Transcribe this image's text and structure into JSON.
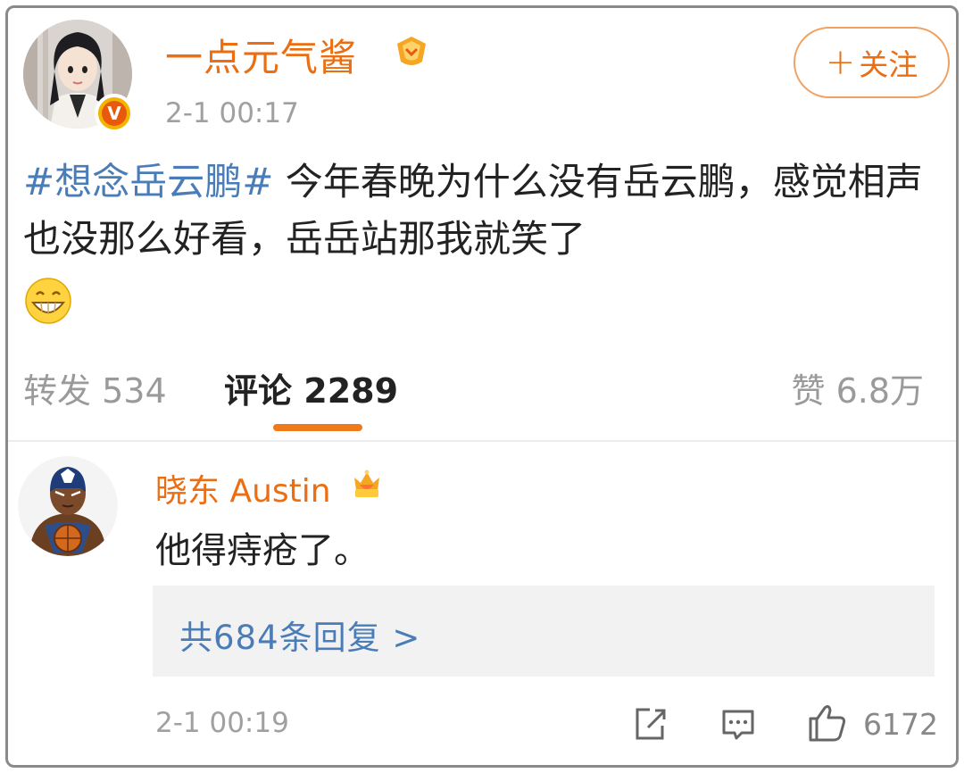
{
  "post": {
    "username": "一点元气酱",
    "time": "2-1 00:17",
    "follow_label": "关注",
    "follow_plus": "+",
    "verified_mark": "V",
    "hashtag": "#想念岳云鹏#",
    "text": " 今年春晚为什么没有岳云鹏，感觉相声也没那么好看，岳岳站那我就笑了",
    "emoji": "grinning-face-emoji"
  },
  "stats": {
    "repost_label": "转发",
    "repost_count": "534",
    "comment_label": "评论",
    "comment_count": "2289",
    "like_label": "赞",
    "like_count": "6.8万"
  },
  "comment": {
    "username": "晓东 Austin",
    "text": "他得痔疮了。",
    "replies_link": "共684条回复 >",
    "time": "2-1 00:19",
    "like_count": "6172"
  },
  "colors": {
    "accent_orange": "#eb6e12",
    "link_blue": "#4a7db8",
    "muted_gray": "#a0a0a0"
  },
  "icons": {
    "user_badge": "gold-badge-icon",
    "commenter_badge": "crown-badge-icon",
    "share": "share-icon",
    "reply": "reply-icon",
    "like": "thumbs-up-icon"
  }
}
